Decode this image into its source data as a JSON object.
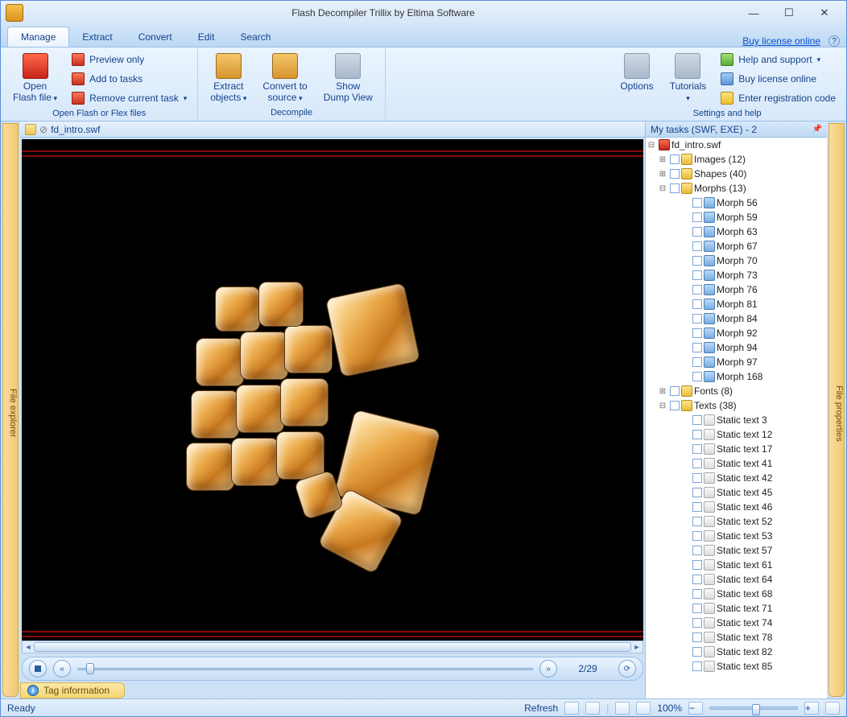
{
  "window_title": "Flash Decompiler Trillix by Eltima Software",
  "tabs": [
    "Manage",
    "Extract",
    "Convert",
    "Edit",
    "Search"
  ],
  "active_tab": 0,
  "buy_link": "Buy license online",
  "ribbon": {
    "open_flash": "Open Flash file",
    "preview_only": "Preview only",
    "add_tasks": "Add to tasks",
    "remove_task": "Remove current task",
    "group_open": "Open Flash or Flex files",
    "extract_objects": "Extract objects",
    "convert_source": "Convert to source",
    "show_dump": "Show Dump View",
    "group_decompile": "Decompile",
    "options": "Options",
    "tutorials": "Tutorials",
    "help_support": "Help and support",
    "buy_license": "Buy license online",
    "enter_reg": "Enter registration code",
    "group_settings": "Settings and help"
  },
  "left_tab": "File explorer",
  "right_tab": "File properties",
  "open_file_tab": "fd_intro.swf",
  "playbar": {
    "page": "2/29"
  },
  "tag_info": "Tag information",
  "tasks_header": "My tasks (SWF, EXE) - 2",
  "tree": {
    "root": "fd_intro.swf",
    "folders": [
      {
        "label": "Images (12)",
        "expanded": false
      },
      {
        "label": "Shapes (40)",
        "expanded": false
      },
      {
        "label": "Morphs (13)",
        "expanded": true,
        "children": [
          "Morph 56",
          "Morph 59",
          "Morph 63",
          "Morph 67",
          "Morph 70",
          "Morph 73",
          "Morph 76",
          "Morph 81",
          "Morph 84",
          "Morph 92",
          "Morph 94",
          "Morph 97",
          "Morph 168"
        ]
      },
      {
        "label": "Fonts (8)",
        "expanded": false
      },
      {
        "label": "Texts (38)",
        "expanded": true,
        "children": [
          "Static text 3",
          "Static text 12",
          "Static text 17",
          "Static text 41",
          "Static text 42",
          "Static text 45",
          "Static text 46",
          "Static text 52",
          "Static text 53",
          "Static text 57",
          "Static text 61",
          "Static text 64",
          "Static text 68",
          "Static text 71",
          "Static text 74",
          "Static text 78",
          "Static text 82",
          "Static text 85"
        ]
      }
    ]
  },
  "statusbar": {
    "ready": "Ready",
    "refresh": "Refresh",
    "zoom": "100%"
  }
}
